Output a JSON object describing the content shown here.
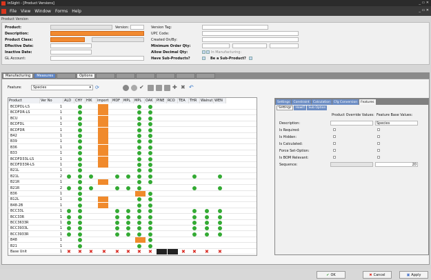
{
  "app": {
    "title": "inSight - [Product Versions]",
    "window_controls": "_ ▭ ✕",
    "child_controls": "_ ▭ ✕"
  },
  "menu": [
    "File",
    "View",
    "Window",
    "Forms",
    "Help"
  ],
  "section": "Product Version",
  "form": {
    "product_label": "Product:",
    "version_label": "Version:",
    "description_label": "Description:",
    "product_class_label": "Product Class:",
    "effective_date_label": "Effective Date:",
    "inactive_date_label": "Inactive Date:",
    "gl_account_label": "GL Account:",
    "version_tag_label": "Version Tag:",
    "upc_label": "UPC Code:",
    "created_label": "Created On/By:",
    "min_order_label": "Minimum Order Qty:",
    "allow_decimal_label": "Allow Decimal Qty:",
    "sub_products_label": "Have Sub-Products?",
    "in_manufacturing_label": "In Manufacturing:",
    "be_sub_product_label": "Be a Sub-Product?"
  },
  "tabs": [
    "Manufacturing",
    "Measures",
    "",
    "Options",
    "",
    "",
    "",
    "",
    "",
    ""
  ],
  "active_tab_index": 3,
  "feature_label": "Feature:",
  "feature_value": "Species",
  "grid": {
    "columns": [
      "Product",
      "Ver No",
      "ALD",
      "CHY",
      "HIK",
      "import",
      "MDF",
      "MPL",
      "MPL",
      "OAK",
      "PINE",
      "RCO",
      "TEA",
      "THR",
      "Walnut",
      "WEN"
    ],
    "rows": [
      {
        "product": "BCDPDL-LS",
        "ver": "1"
      },
      {
        "product": "BCDFDR-LS",
        "ver": "1"
      },
      {
        "product": "BCU",
        "ver": "1"
      },
      {
        "product": "BCDFDL",
        "ver": "1"
      },
      {
        "product": "BCDFDR",
        "ver": "1"
      },
      {
        "product": "B42",
        "ver": "1"
      },
      {
        "product": "B39",
        "ver": "1"
      },
      {
        "product": "B36",
        "ver": "1"
      },
      {
        "product": "B33",
        "ver": "1"
      },
      {
        "product": "BCDFD33L-LS",
        "ver": "1"
      },
      {
        "product": "BCDFD33R-LS",
        "ver": "1"
      },
      {
        "product": "B21L",
        "ver": "1"
      },
      {
        "product": "B21L",
        "ver": "2"
      },
      {
        "product": "B21R",
        "ver": "1"
      },
      {
        "product": "B21R",
        "ver": "2"
      },
      {
        "product": "B36",
        "ver": "1"
      },
      {
        "product": "B12L",
        "ver": "1"
      },
      {
        "product": "B48-2B",
        "ver": "1"
      },
      {
        "product": "BCC33L",
        "ver": "1"
      },
      {
        "product": "BCC33R",
        "ver": "1"
      },
      {
        "product": "BCC3633R",
        "ver": "1"
      },
      {
        "product": "BCC3933L",
        "ver": "1"
      },
      {
        "product": "BCC3933R",
        "ver": "1"
      },
      {
        "product": "B48",
        "ver": "1"
      },
      {
        "product": "B21",
        "ver": "1"
      },
      {
        "product": "Base Unit",
        "ver": "1"
      }
    ]
  },
  "right_tabs": [
    "Settings",
    "Constraint",
    "Calculation",
    "Cfg Conversion",
    "Features"
  ],
  "right_subtabs": [
    "Settings",
    "HowIT",
    "Sub Option"
  ],
  "props": {
    "col1_header": "Product Override Values:",
    "col2_header": "Feature Base Values:",
    "description_label": "Description:",
    "description_value": "Species",
    "required_label": "Is Required:",
    "hidden_label": "Is Hidden:",
    "calculated_label": "Is Calculated:",
    "force_label": "Force Set-Option:",
    "bom_label": "Is BOM Relevant:",
    "sequence_label": "Sequence:",
    "sequence_value": "20"
  },
  "buttons": {
    "ok": "OK",
    "cancel": "Cancel",
    "apply": "Apply"
  }
}
